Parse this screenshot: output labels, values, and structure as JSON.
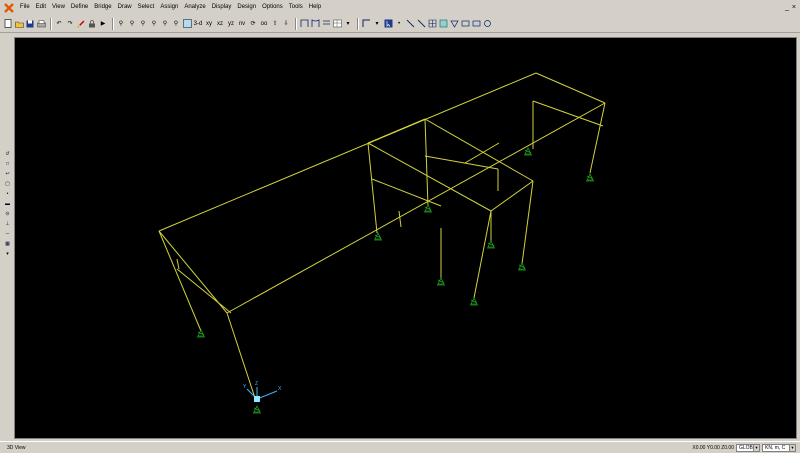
{
  "menu": {
    "items": [
      "File",
      "Edit",
      "View",
      "Define",
      "Bridge",
      "Draw",
      "Select",
      "Assign",
      "Analyze",
      "Display",
      "Design",
      "Options",
      "Tools",
      "Help"
    ],
    "window_controls": [
      "_",
      "×"
    ]
  },
  "toolbar": {
    "view_3d_label": "3-d",
    "view_xy_label": "xy",
    "view_xz_label": "xz",
    "view_yz_label": "yz",
    "view_nv_label": "nv",
    "view_oo_label": "oo"
  },
  "viewport": {
    "title": "3D View",
    "background": "#000000",
    "frame_color": "#d2d23c",
    "support_color": "#1fa51f",
    "axis_labels": [
      "X",
      "Y",
      "Z"
    ]
  },
  "status": {
    "view_label": "3D View",
    "coordinates": "X0.00  Y0.00  Z0.00",
    "coord_system": "GLOBAL",
    "units": "KN, m, C"
  },
  "colors": {
    "chrome": "#d4d0c8",
    "accent": "#0a246a"
  }
}
